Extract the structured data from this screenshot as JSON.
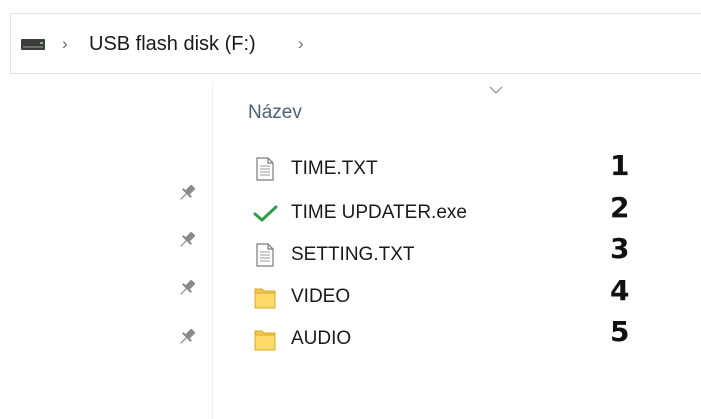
{
  "address_bar": {
    "drive_icon": "usb-drive-icon",
    "location_label": "USB flash disk (F:)",
    "separator": "›"
  },
  "file_list": {
    "column_header": "Název",
    "items": [
      {
        "name": "TIME.TXT",
        "icon": "text-file-icon"
      },
      {
        "name": "TIME UPDATER.exe",
        "icon": "green-checkmark-icon"
      },
      {
        "name": "SETTING.TXT",
        "icon": "text-file-icon"
      },
      {
        "name": "VIDEO",
        "icon": "folder-icon"
      },
      {
        "name": "AUDIO",
        "icon": "folder-icon"
      }
    ]
  },
  "annotations": [
    "1",
    "2",
    "3",
    "4",
    "5"
  ],
  "colors": {
    "folder": "#f4c94d",
    "check": "#2f9e44",
    "header_text": "#4c607a",
    "border": "#e2e2e2"
  }
}
